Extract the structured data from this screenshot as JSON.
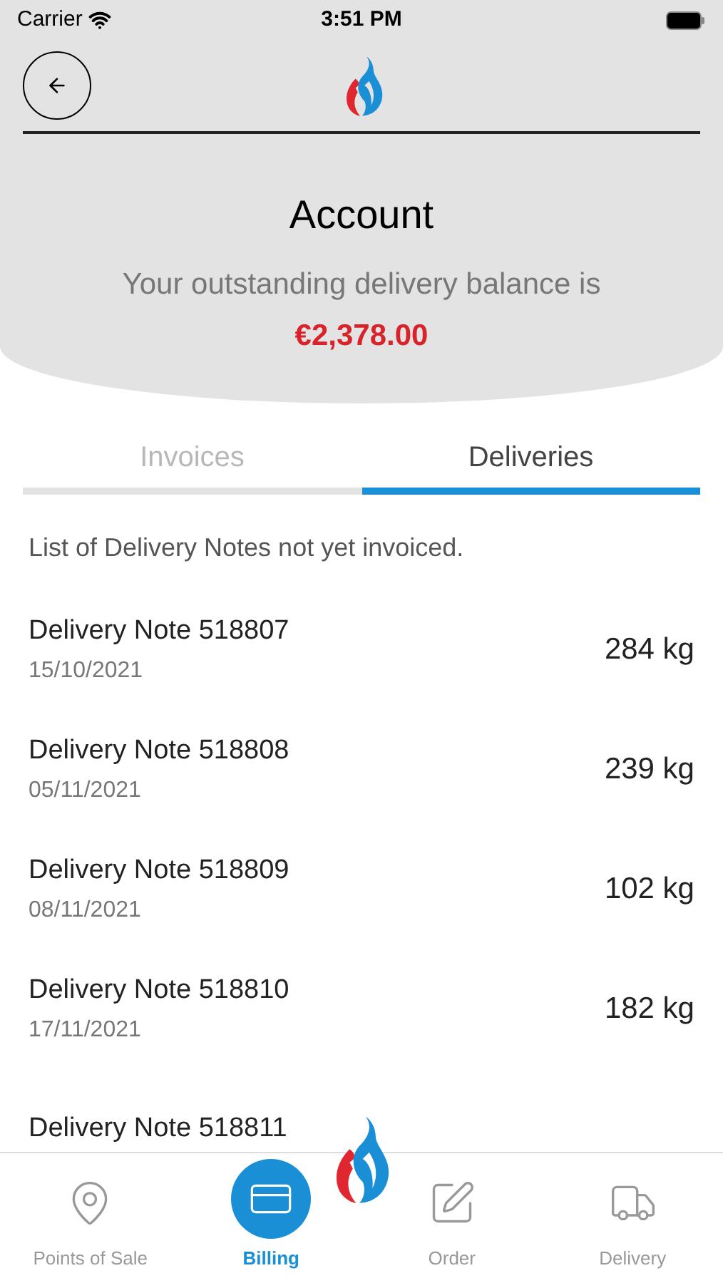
{
  "status_bar": {
    "carrier": "Carrier",
    "time": "3:51 PM"
  },
  "header": {
    "title": "Account",
    "subtitle": "Your outstanding delivery balance is",
    "balance": "€2,378.00"
  },
  "tabs": [
    {
      "label": "Invoices",
      "selected": false
    },
    {
      "label": "Deliveries",
      "selected": true
    }
  ],
  "description": "List of Delivery Notes not yet invoiced.",
  "deliveries": [
    {
      "title": "Delivery Note 518807",
      "date": "15/10/2021",
      "weight": "284 kg"
    },
    {
      "title": "Delivery Note 518808",
      "date": "05/11/2021",
      "weight": "239 kg"
    },
    {
      "title": "Delivery Note 518809",
      "date": "08/11/2021",
      "weight": "102 kg"
    },
    {
      "title": "Delivery Note 518810",
      "date": "17/11/2021",
      "weight": "182 kg"
    },
    {
      "title": "Delivery Note 518811"
    }
  ],
  "tab_bar": [
    {
      "kind": "pin",
      "label": "Points of Sale",
      "selected": false
    },
    {
      "kind": "card",
      "label": "Billing",
      "selected": true
    },
    {
      "kind": "edit",
      "label": "Order",
      "selected": false
    },
    {
      "kind": "truck",
      "label": "Delivery",
      "selected": false
    }
  ]
}
